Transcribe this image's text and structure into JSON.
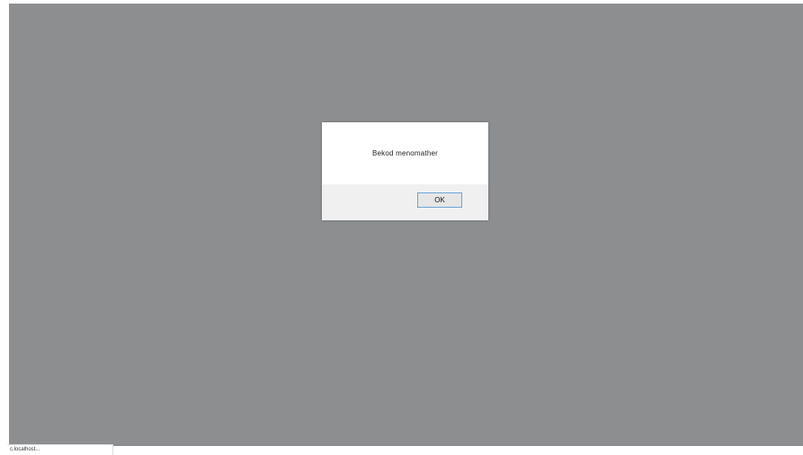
{
  "dialog": {
    "message": "Bekod menomather",
    "ok_label": "OK"
  },
  "status_bar": {
    "text": "c.localhost..."
  },
  "colors": {
    "overlay": "#8d8e90",
    "dialog_bg": "#ffffff",
    "dialog_footer": "#f0f0f0",
    "button_border": "#6ea4d8"
  }
}
